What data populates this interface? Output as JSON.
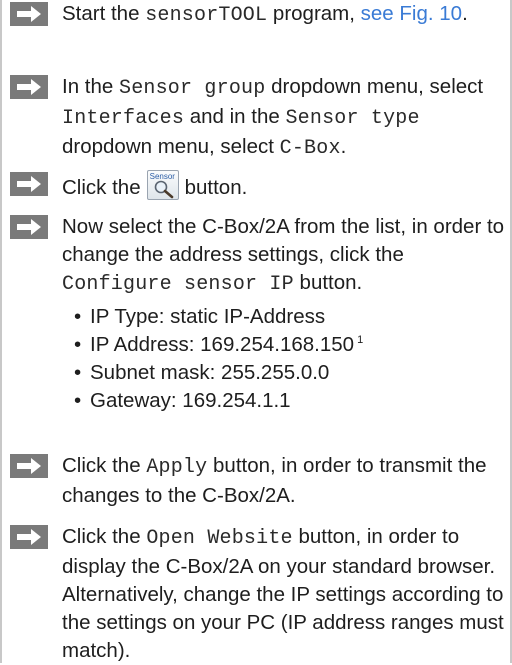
{
  "steps": {
    "s1": {
      "pre": "Start the ",
      "code": "sensorTOOL",
      "mid": " program, ",
      "link": "see Fig. 10",
      "post": "."
    },
    "s2": {
      "t1": "In the ",
      "c1": "Sensor group",
      "t2": " dropdown menu, select ",
      "c2": "Interfaces",
      "t3": " and in the ",
      "c3": "Sensor type",
      "t4": " dropdown menu, select ",
      "c4": "C-Box",
      "t5": "."
    },
    "s3": {
      "pre": "Click the",
      "button_label": "Sensor",
      "post": "button."
    },
    "s4": {
      "pre": "Now select the C-Box/2A from the list, in order to change the address settings, click the ",
      "code": "Configure sensor IP",
      "post": " button."
    },
    "settings": [
      {
        "text": "IP Type: static IP-Address",
        "footnote": ""
      },
      {
        "text": "IP Address: 169.254.168.150",
        "footnote": "1"
      },
      {
        "text": "Subnet mask: 255.255.0.0",
        "footnote": ""
      },
      {
        "text": "Gateway: 169.254.1.1",
        "footnote": ""
      }
    ],
    "s5": {
      "pre": "Click the ",
      "code": "Apply",
      "post": " button, in order to trans­mit the changes to the C-Box/2A."
    },
    "s6": {
      "pre": "Click the ",
      "code": "Open Website",
      "post": " button, in or­der to display the C-Box/2A on your stan­dard browser. Alternatively, change the IP settings according to the settings on your PC (IP address ranges must match)."
    }
  },
  "icons": {
    "step_arrow": "right-arrow-icon",
    "sensor_button": "magnifier-icon"
  },
  "colors": {
    "link": "#3a7bd5",
    "arrow_box": "#7a7a7a"
  }
}
